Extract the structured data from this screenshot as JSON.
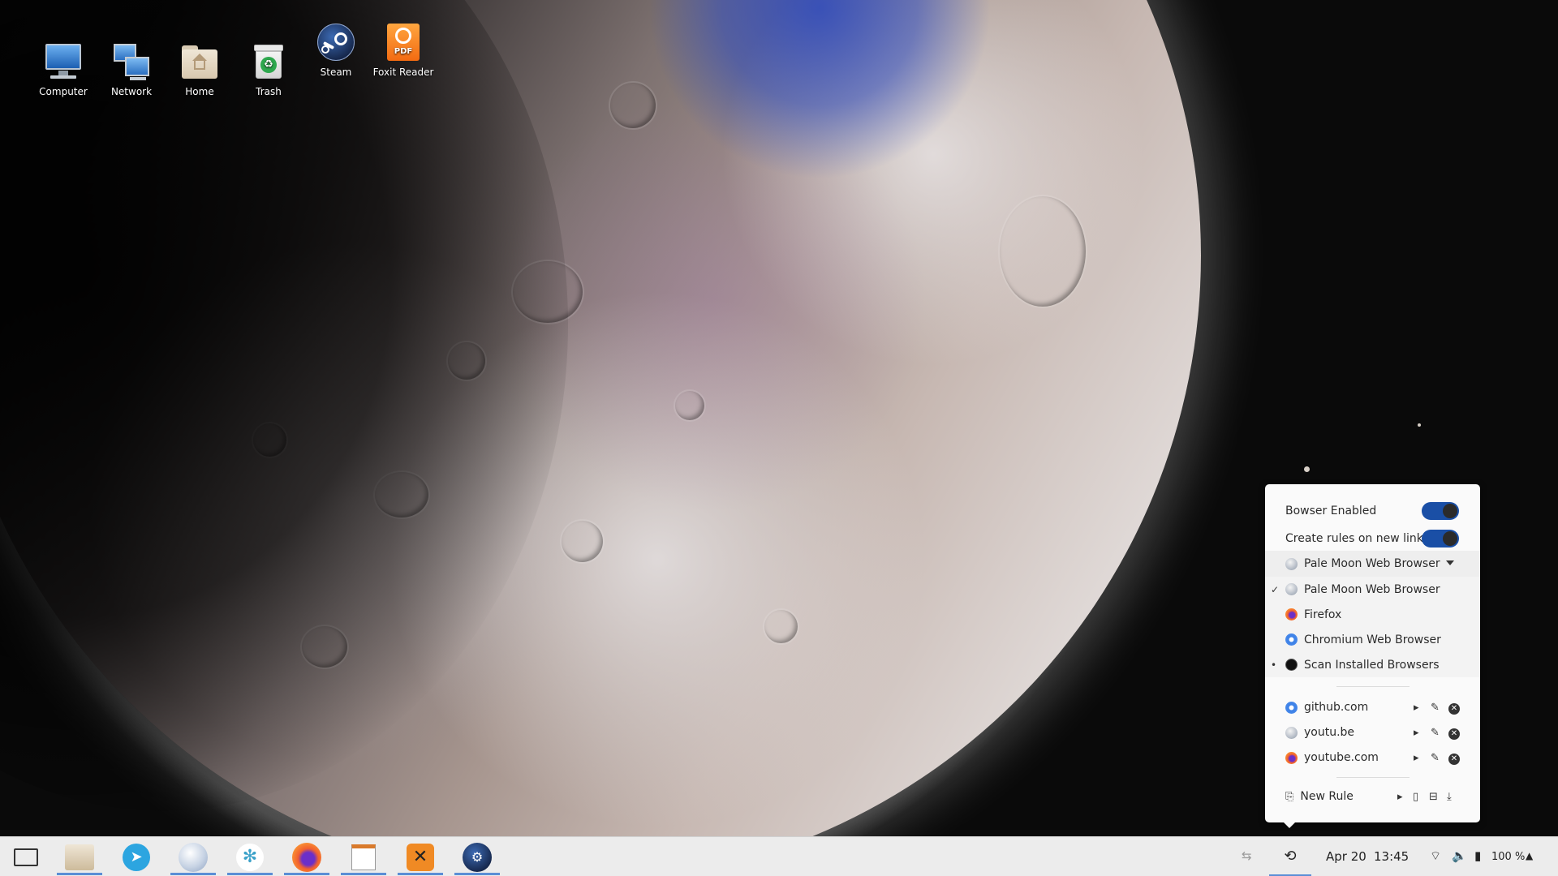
{
  "desktop": {
    "icons": [
      {
        "label": "Computer",
        "icon": "computer-icon"
      },
      {
        "label": "Network",
        "icon": "network-icon"
      },
      {
        "label": "Home",
        "icon": "home-folder-icon"
      },
      {
        "label": "Trash",
        "icon": "trash-icon"
      },
      {
        "label": "Steam",
        "icon": "steam-icon"
      },
      {
        "label": "Foxit Reader",
        "icon": "foxit-reader-icon"
      }
    ]
  },
  "popup": {
    "bowser_enabled_label": "Bowser Enabled",
    "bowser_enabled": true,
    "create_rules_label": "Create rules on new links",
    "create_rules": true,
    "default_browser": "Pale Moon Web Browser",
    "browsers": [
      {
        "label": "Pale Moon Web Browser",
        "icon": "pale-moon-icon",
        "checked": true,
        "mark": "✓"
      },
      {
        "label": "Firefox",
        "icon": "firefox-icon",
        "checked": false,
        "mark": ""
      },
      {
        "label": "Chromium Web Browser",
        "icon": "chromium-icon",
        "checked": false,
        "mark": ""
      },
      {
        "label": "Scan Installed Browsers",
        "icon": "scan-icon",
        "checked": false,
        "mark": "•"
      }
    ],
    "rules": [
      {
        "domain": "github.com",
        "icon": "chromium-icon"
      },
      {
        "domain": "youtu.be",
        "icon": "pale-moon-icon"
      },
      {
        "domain": "youtube.com",
        "icon": "firefox-icon"
      }
    ],
    "new_rule_label": "New Rule"
  },
  "taskbar": {
    "apps": [
      {
        "name": "show-desktop"
      },
      {
        "name": "file-manager"
      },
      {
        "name": "telegram"
      },
      {
        "name": "pale-moon"
      },
      {
        "name": "codium"
      },
      {
        "name": "firefox"
      },
      {
        "name": "text-editor"
      },
      {
        "name": "game-launcher"
      },
      {
        "name": "steam"
      }
    ],
    "date": "Apr 20",
    "time": "13:45",
    "battery": "100 %"
  },
  "colors": {
    "accent": "#1a4fa6",
    "taskbar_bg": "#ececec",
    "popup_bg": "#fafafa"
  }
}
